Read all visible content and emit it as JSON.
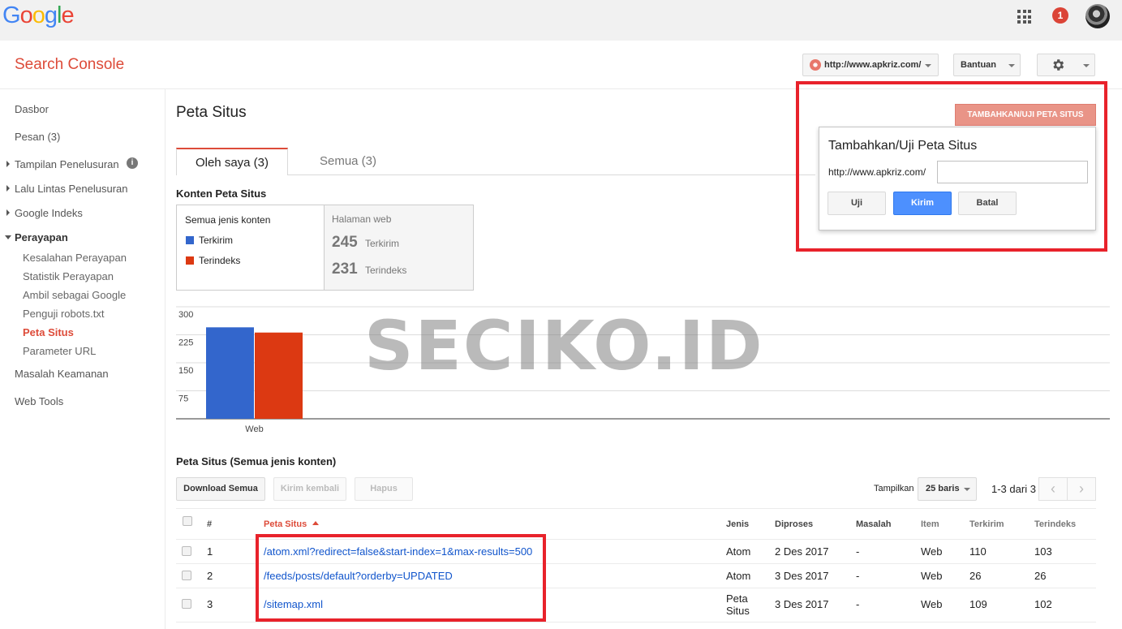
{
  "google": {
    "logo_letters": [
      "G",
      "o",
      "o",
      "g",
      "l",
      "e"
    ],
    "logo_colors": [
      "#4285f4",
      "#ea4335",
      "#fbbc05",
      "#4285f4",
      "#34a853",
      "#ea4335"
    ],
    "notification_count": "1"
  },
  "header": {
    "app_title": "Search Console",
    "site_selector": "http://www.apkriz.com/",
    "help_label": "Bantuan",
    "settings_icon": "gear-icon"
  },
  "sidebar": {
    "items": [
      {
        "label": "Dasbor"
      },
      {
        "label": "Pesan (3)"
      },
      {
        "label": "Tampilan Penelusuran"
      },
      {
        "label": "Lalu Lintas Penelusuran"
      },
      {
        "label": "Google Indeks"
      },
      {
        "label": "Perayapan"
      },
      {
        "label": "Kesalahan Perayapan"
      },
      {
        "label": "Statistik Perayapan"
      },
      {
        "label": "Ambil sebagai Google"
      },
      {
        "label": "Penguji robots.txt"
      },
      {
        "label": "Peta Situs"
      },
      {
        "label": "Parameter URL"
      },
      {
        "label": "Masalah Keamanan"
      },
      {
        "label": "Web Tools"
      }
    ],
    "info_glyph": "i"
  },
  "main": {
    "page_title": "Peta Situs",
    "tabs": [
      {
        "label": "Oleh saya (3)"
      },
      {
        "label": "Semua (3)"
      }
    ],
    "content_title": "Konten Peta Situs",
    "type_box": {
      "heading": "Semua jenis konten",
      "legend": [
        {
          "label": "Terkirim",
          "color": "#3366cc"
        },
        {
          "label": "Terindeks",
          "color": "#dc3912"
        }
      ]
    },
    "web_box": {
      "heading": "Halaman web",
      "submitted_value": "245",
      "submitted_label": "Terkirim",
      "indexed_value": "231",
      "indexed_label": "Terindeks"
    }
  },
  "chart_data": {
    "type": "bar",
    "categories": [
      "Web"
    ],
    "series": [
      {
        "name": "Terkirim",
        "values": [
          245
        ],
        "color": "#3366cc"
      },
      {
        "name": "Terindeks",
        "values": [
          231
        ],
        "color": "#dc3912"
      }
    ],
    "y_ticks": [
      300,
      225,
      150,
      75
    ],
    "ylim": [
      0,
      300
    ],
    "grid": true
  },
  "sitemaps": {
    "section_title": "Peta Situs (Semua jenis konten)",
    "toolbar": {
      "download": "Download Semua",
      "resubmit": "Kirim kembali",
      "delete": "Hapus",
      "show_label": "Tampilkan",
      "rows_value": "25 baris",
      "range": "1-3 dari 3",
      "prev_glyph": "‹",
      "next_glyph": "›"
    },
    "columns": {
      "num": "#",
      "sitemap": "Peta Situs",
      "type": "Jenis",
      "processed": "Diproses",
      "issues": "Masalah",
      "item": "Item",
      "submitted": "Terkirim",
      "indexed": "Terindeks"
    },
    "rows": [
      {
        "num": "1",
        "path": "/atom.xml?redirect=false&start-index=1&max-results=500",
        "type": "Atom",
        "type2": "",
        "processed": "2 Des 2017",
        "issues": "-",
        "item": "Web",
        "submitted": "110",
        "indexed": "103"
      },
      {
        "num": "2",
        "path": "/feeds/posts/default?orderby=UPDATED",
        "type": "Atom",
        "type2": "",
        "processed": "3 Des 2017",
        "issues": "-",
        "item": "Web",
        "submitted": "26",
        "indexed": "26"
      },
      {
        "num": "3",
        "path": "/sitemap.xml",
        "type": "Peta",
        "type2": "Situs",
        "processed": "3 Des 2017",
        "issues": "-",
        "item": "Web",
        "submitted": "109",
        "indexed": "102"
      }
    ]
  },
  "popup": {
    "open_button": "TAMBAHKAN/UJI PETA SITUS",
    "title": "Tambahkan/Uji Peta Situs",
    "prefix": "http://www.apkriz.com/",
    "input_value": "",
    "test": "Uji",
    "submit": "Kirim",
    "cancel": "Batal"
  },
  "watermark": "SECIKO.ID"
}
